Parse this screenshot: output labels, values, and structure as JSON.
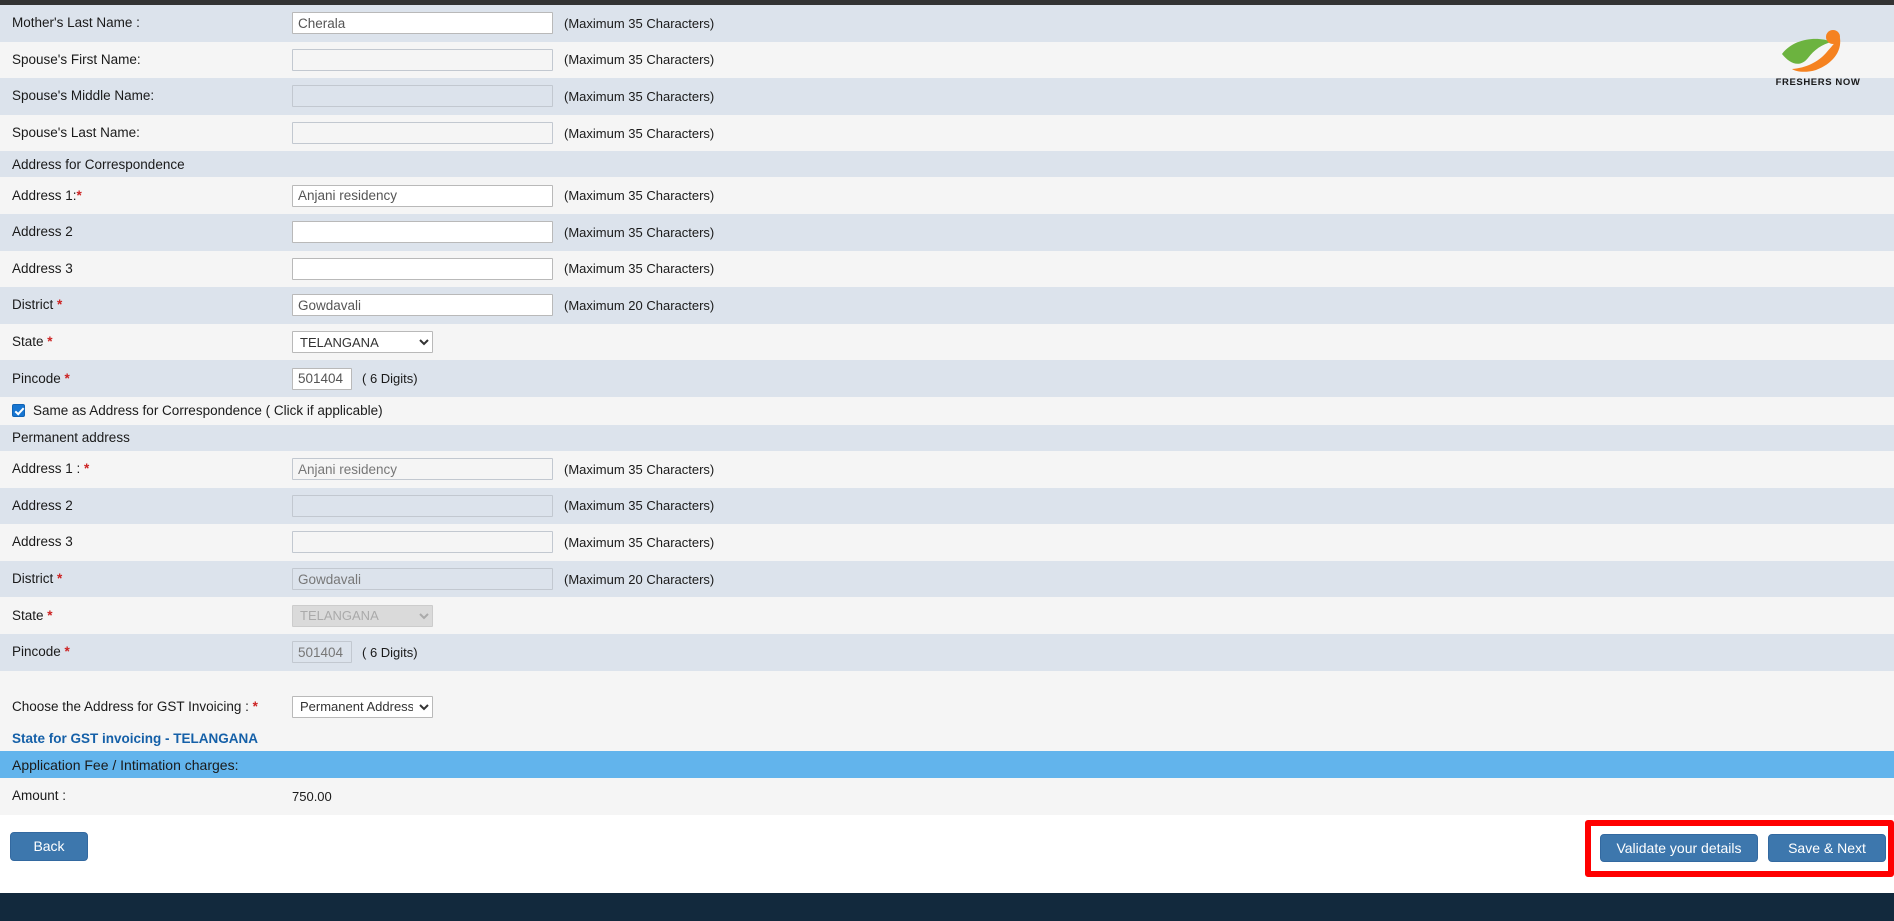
{
  "hints": {
    "max35": "(Maximum 35 Characters)",
    "max20": "(Maximum 20 Characters)",
    "digits6": "( 6 Digits)"
  },
  "logo": {
    "name": "freshers-now-logo",
    "text": "FRESHERS NOW"
  },
  "fields": {
    "mother_last_name": {
      "label": "Mother's Last Name :",
      "value": "Cherala",
      "hint": "(Maximum 35 Characters)"
    },
    "spouse_first_name": {
      "label": "Spouse's First Name:",
      "value": "",
      "hint": "(Maximum 35 Characters)"
    },
    "spouse_middle_name": {
      "label": "Spouse's Middle Name:",
      "value": "",
      "hint": "(Maximum 35 Characters)"
    },
    "spouse_last_name": {
      "label": "Spouse's Last Name:",
      "value": "",
      "hint": "(Maximum 35 Characters)"
    }
  },
  "correspondence": {
    "section_title": "Address for Correspondence",
    "address1": {
      "label": "Address 1:",
      "required": "*",
      "value": "Anjani residency",
      "hint": "(Maximum 35 Characters)"
    },
    "address2": {
      "label": "Address 2",
      "value": "",
      "hint": "(Maximum 35 Characters)"
    },
    "address3": {
      "label": "Address 3",
      "value": "",
      "hint": "(Maximum 35 Characters)"
    },
    "district": {
      "label": "District ",
      "required": "*",
      "value": "Gowdavali",
      "hint": "(Maximum 20 Characters)"
    },
    "state": {
      "label": "State ",
      "required": "*",
      "value": "TELANGANA"
    },
    "pincode": {
      "label": "Pincode ",
      "required": "*",
      "value": "501404",
      "hint": "( 6 Digits)"
    }
  },
  "same_as_checkbox": {
    "label": "Same as Address for Correspondence ( Click if applicable)",
    "checked": true
  },
  "permanent": {
    "section_title": "Permanent address",
    "address1": {
      "label": "Address 1 : ",
      "required": "*",
      "value": "Anjani residency",
      "hint": "(Maximum 35 Characters)"
    },
    "address2": {
      "label": "Address 2",
      "value": "",
      "hint": "(Maximum 35 Characters)"
    },
    "address3": {
      "label": "Address 3",
      "value": "",
      "hint": "(Maximum 35 Characters)"
    },
    "district": {
      "label": "District ",
      "required": "*",
      "value": "Gowdavali",
      "hint": "(Maximum 20 Characters)"
    },
    "state": {
      "label": "State ",
      "required": "*",
      "value": "TELANGANA"
    },
    "pincode": {
      "label": "Pincode ",
      "required": "*",
      "value": "501404",
      "hint": "( 6 Digits)"
    }
  },
  "gst": {
    "choose_label": "Choose the Address for GST Invoicing : ",
    "required": "*",
    "selected": "Permanent Address",
    "state_line": "State for GST invoicing - TELANGANA"
  },
  "fee": {
    "heading": "Application Fee / Intimation charges:",
    "amount_label": "Amount :",
    "amount_value": "750.00"
  },
  "buttons": {
    "back": "Back",
    "validate": "Validate your details",
    "save_next": "Save & Next"
  },
  "colors": {
    "row_odd": "#dce3ec",
    "row_even": "#f5f5f5",
    "fee_header": "#62b4ec",
    "button_blue": "#3d77ad",
    "link_blue": "#1560a8",
    "annotation_red": "#ff0000",
    "footer_navy": "#12293d"
  }
}
